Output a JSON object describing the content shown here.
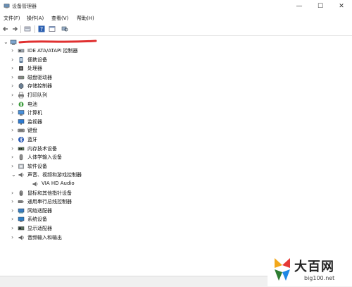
{
  "window": {
    "title": "设备管理器",
    "minimize": "—",
    "maximize": "☐",
    "close": "✕"
  },
  "menu": [
    "文件(F)",
    "操作(A)",
    "查看(V)",
    "帮助(H)"
  ],
  "tree": {
    "root_label": "",
    "items": [
      {
        "label": "IDE ATA/ATAPI 控制器",
        "icon": "ide-controller-icon",
        "expanded": false
      },
      {
        "label": "便携设备",
        "icon": "portable-device-icon",
        "expanded": false
      },
      {
        "label": "处理器",
        "icon": "processor-icon",
        "expanded": false
      },
      {
        "label": "磁盘驱动器",
        "icon": "disk-drive-icon",
        "expanded": false
      },
      {
        "label": "存储控制器",
        "icon": "storage-controller-icon",
        "expanded": false
      },
      {
        "label": "打印队列",
        "icon": "printer-icon",
        "expanded": false
      },
      {
        "label": "电池",
        "icon": "battery-icon",
        "expanded": false
      },
      {
        "label": "计算机",
        "icon": "computer-icon",
        "expanded": false
      },
      {
        "label": "监视器",
        "icon": "monitor-icon",
        "expanded": false
      },
      {
        "label": "键盘",
        "icon": "keyboard-icon",
        "expanded": false
      },
      {
        "label": "蓝牙",
        "icon": "bluetooth-icon",
        "expanded": false
      },
      {
        "label": "内存技术设备",
        "icon": "memory-device-icon",
        "expanded": false
      },
      {
        "label": "人体学输入设备",
        "icon": "hid-icon",
        "expanded": false
      },
      {
        "label": "软件设备",
        "icon": "software-device-icon",
        "expanded": false
      },
      {
        "label": "声音、视频和游戏控制器",
        "icon": "speaker-icon",
        "expanded": true
      },
      {
        "label": "VIA HD Audio",
        "icon": "speaker-icon",
        "child": true
      },
      {
        "label": "鼠标和其他指针设备",
        "icon": "mouse-icon",
        "expanded": false
      },
      {
        "label": "通用串行总线控制器",
        "icon": "usb-icon",
        "expanded": false
      },
      {
        "label": "网络适配器",
        "icon": "network-adapter-icon",
        "expanded": false
      },
      {
        "label": "系统设备",
        "icon": "system-device-icon",
        "expanded": false
      },
      {
        "label": "显示适配器",
        "icon": "display-adapter-icon",
        "expanded": false
      },
      {
        "label": "音频输入和输出",
        "icon": "audio-io-icon",
        "expanded": false
      }
    ]
  },
  "watermark": {
    "name": "大百网",
    "url": "big100.net"
  },
  "colors": {
    "redaction": "#e03030",
    "selection": "#cce8ff"
  }
}
